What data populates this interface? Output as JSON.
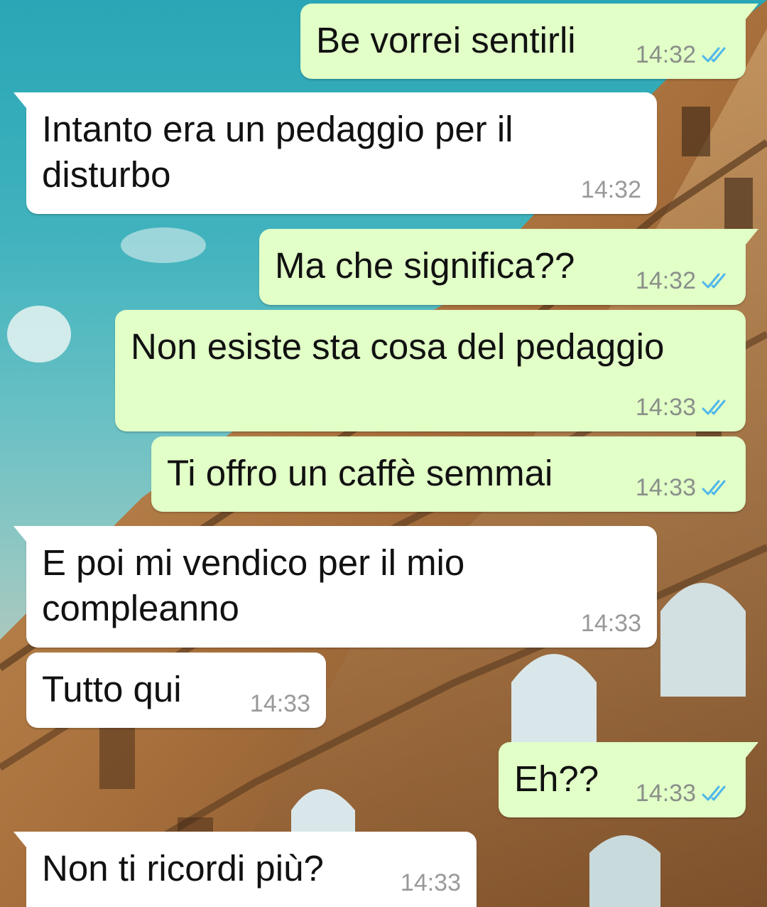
{
  "theme": {
    "outgoing_bubble": "#e1ffc7",
    "incoming_bubble": "#ffffff",
    "read_tick": "#4fb6ec",
    "time_text": "#8a8f8a",
    "message_text": "#111111"
  },
  "messages": [
    {
      "direction": "outgoing",
      "text": "Be vorrei sentirli",
      "time": "14:32",
      "status_icon": "double-check-read-icon"
    },
    {
      "direction": "incoming",
      "text": "Intanto era un pedaggio per il\ndisturbo",
      "time": "14:32"
    },
    {
      "direction": "outgoing",
      "text": "Ma che significa??",
      "time": "14:32",
      "status_icon": "double-check-read-icon"
    },
    {
      "direction": "outgoing",
      "text": "Non esiste sta cosa del pedaggio",
      "time": "14:33",
      "status_icon": "double-check-read-icon"
    },
    {
      "direction": "outgoing",
      "text": "Ti offro un caffè semmai",
      "time": "14:33",
      "status_icon": "double-check-read-icon"
    },
    {
      "direction": "incoming",
      "text": "E poi mi vendico per il mio\ncompleanno",
      "time": "14:33"
    },
    {
      "direction": "incoming",
      "text": "Tutto qui",
      "time": "14:33"
    },
    {
      "direction": "outgoing",
      "text": "Eh??",
      "time": "14:33",
      "status_icon": "double-check-read-icon"
    },
    {
      "direction": "incoming",
      "text": "Non ti ricordi più?",
      "time": "14:33"
    }
  ]
}
